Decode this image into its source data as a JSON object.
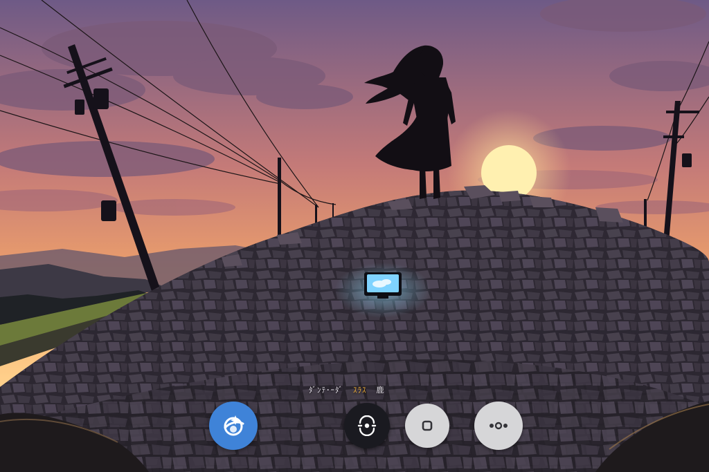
{
  "overlay_caption": {
    "part1": "ﾀﾞﾝﾃ･ｰﾀﾞ",
    "part2": "ｽﾗｽ",
    "part3": "鹿"
  },
  "buttons": [
    {
      "id": "b1",
      "icon": "assistant-sparkle-icon",
      "color": "#3f83d8"
    },
    {
      "id": "b2",
      "icon": "lens-scan-icon",
      "color": "#1a1a20"
    },
    {
      "id": "b3",
      "icon": "shutter-square-icon",
      "color": "#d6d6d8"
    },
    {
      "id": "b4",
      "icon": "more-dots-icon",
      "color": "#d6d6d8"
    }
  ],
  "colors": {
    "sky_top": "#6e5a86",
    "sky_mid": "#e79a6a",
    "sky_horizon": "#ffd28a",
    "sun": "#fff0b0",
    "rocks": "#3b3540",
    "screen_glow": "#7fd3ff"
  }
}
